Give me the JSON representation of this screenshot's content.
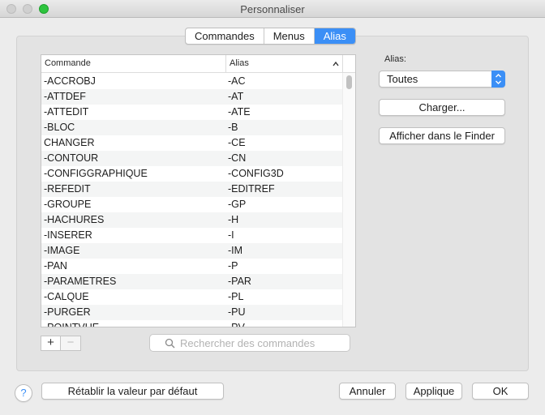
{
  "window": {
    "title": "Personnaliser"
  },
  "tabs": [
    {
      "label": "Commandes",
      "active": false
    },
    {
      "label": "Menus",
      "active": false
    },
    {
      "label": "Alias",
      "active": true
    }
  ],
  "table": {
    "columns": [
      "Commande",
      "Alias"
    ],
    "rows": [
      {
        "command": "-ACCROBJ",
        "alias": "-AC"
      },
      {
        "command": "-ATTDEF",
        "alias": "-AT"
      },
      {
        "command": "-ATTEDIT",
        "alias": "-ATE"
      },
      {
        "command": "-BLOC",
        "alias": "-B"
      },
      {
        "command": "CHANGER",
        "alias": "-CE"
      },
      {
        "command": "-CONTOUR",
        "alias": "-CN"
      },
      {
        "command": "-CONFIGGRAPHIQUE",
        "alias": "-CONFIG3D"
      },
      {
        "command": "-REFEDIT",
        "alias": "-EDITREF"
      },
      {
        "command": "-GROUPE",
        "alias": "-GP"
      },
      {
        "command": "-HACHURES",
        "alias": "-H"
      },
      {
        "command": "-INSERER",
        "alias": "-I"
      },
      {
        "command": "-IMAGE",
        "alias": "-IM"
      },
      {
        "command": "-PAN",
        "alias": "-P"
      },
      {
        "command": "-PARAMETRES",
        "alias": "-PAR"
      },
      {
        "command": "-CALQUE",
        "alias": "-PL"
      },
      {
        "command": "-PURGER",
        "alias": "-PU"
      },
      {
        "command": "-POINTVUE",
        "alias": "-PV"
      }
    ]
  },
  "add_label": "+",
  "remove_label": "−",
  "search": {
    "placeholder": "Rechercher des commandes"
  },
  "alias_filter": {
    "label": "Alias:",
    "value": "Toutes"
  },
  "buttons": {
    "load": "Charger...",
    "show_in_finder": "Afficher dans le Finder",
    "reset": "Rétablir la valeur par défaut",
    "cancel": "Annuler",
    "apply": "Applique",
    "ok": "OK",
    "help": "?"
  },
  "colors": {
    "accent": "#3b8ff6",
    "zoom": "#2dc43e"
  }
}
